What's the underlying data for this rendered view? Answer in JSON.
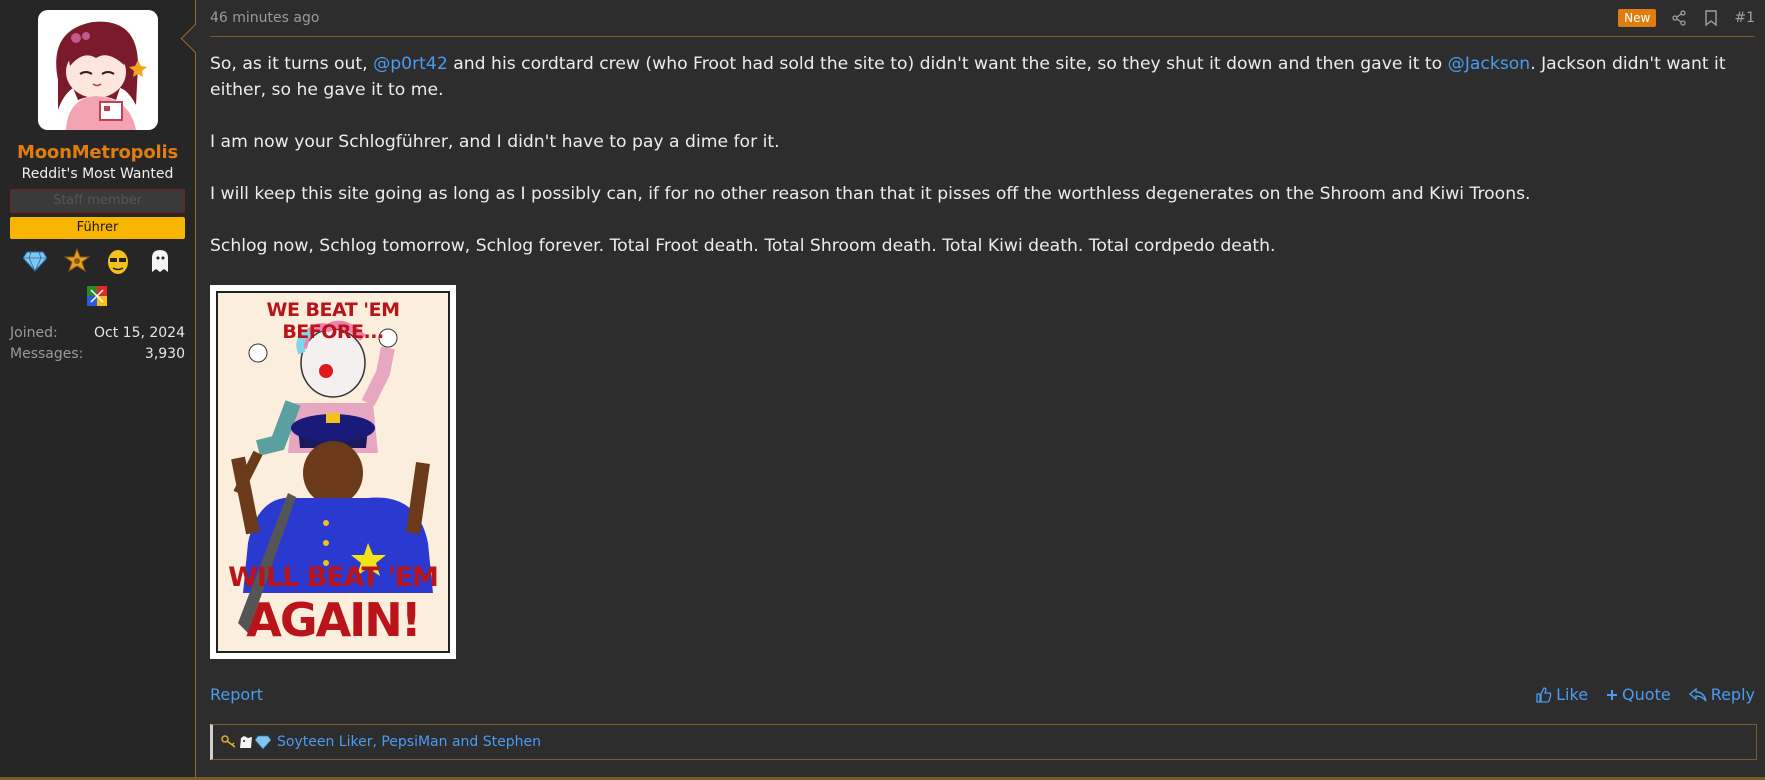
{
  "user": {
    "name": "MoonMetropolis",
    "title": "Reddit's Most Wanted",
    "staff_banner": "Staff member",
    "rank_banner": "Führer",
    "trophies": [
      "diamond-icon",
      "sheriff-star-icon",
      "yellow-face-icon",
      "ghost-icon"
    ],
    "trophies_row2": [
      "puzzle-flag-icon"
    ],
    "stats": [
      {
        "key": "Joined:",
        "value": "Oct 15, 2024"
      },
      {
        "key": "Messages:",
        "value": "3,930"
      }
    ]
  },
  "post": {
    "timestamp": "46 minutes ago",
    "badge": "New",
    "number": "#1",
    "body": {
      "p1_a": "So, as it turns out, ",
      "mention1": "@p0rt42",
      "p1_b": " and his cordtard crew (who Froot had sold the site to) didn't want the site, so they shut it down and then gave it to ",
      "mention2": "@Jackson",
      "p1_c": ". Jackson didn't want it either, so he gave it to me.",
      "p2": "I am now your Schlogführer, and I didn't have to pay a dime for it.",
      "p3": "I will keep this site going as long as I possibly can, if for no other reason than that it pisses off the worthless degenerates on the Shroom and Kiwi Troons.",
      "p4": "Schlog now, Schlog tomorrow, Schlog forever. Total Froot death. Total Shroom death. Total Kiwi death. Total cordpedo death."
    },
    "attachment": {
      "top_text": "WE BEAT 'EM BEFORE...",
      "bottom_text_1": "WILL BEAT 'EM",
      "bottom_text_2": "AGAIN!"
    },
    "actions": {
      "report": "Report",
      "like": "Like",
      "quote": "Quote",
      "reply": "Reply"
    },
    "reactions": {
      "icons": [
        "key-icon",
        "dog-icon",
        "diamond-icon"
      ],
      "text": "Soyteen Liker, PepsiMan and Stephen"
    }
  },
  "colors": {
    "accent": "#e07d10",
    "link": "#4a9cf0",
    "rank_banner": "#f7b500",
    "background": "#2d2d2d"
  }
}
